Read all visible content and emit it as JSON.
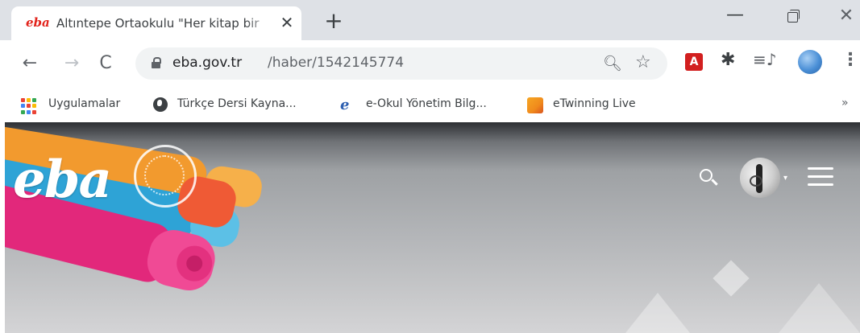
{
  "browser": {
    "tab": {
      "favicon_text": "eba",
      "title": "Altıntepe Ortaokulu \"Her kitap bir",
      "close_glyph": "✕"
    },
    "new_tab_glyph": "+",
    "window_controls": {
      "minimize_glyph": "—",
      "close_glyph": "✕"
    },
    "nav": {
      "back_glyph": "←",
      "forward_glyph": "→",
      "reload_glyph": "C"
    },
    "address": {
      "domain": "eba.gov.tr",
      "path": "/haber/1542145774"
    },
    "toolbar_icons": {
      "zoom_glyph": "🔍︎",
      "star_glyph": "☆",
      "pdf_ext_glyph": "A",
      "puzzle_glyph": "✱",
      "media_glyph": "≡♪",
      "menu_glyph": "⋮"
    },
    "bookmarks": [
      {
        "label": "Uygulamalar",
        "icon": "apps-grid-icon"
      },
      {
        "label": "Türkçe Dersi Kayna...",
        "icon": "globe-icon"
      },
      {
        "label": "e-Okul Yönetim Bilg...",
        "icon": "eokul-icon"
      },
      {
        "label": "eTwinning Live",
        "icon": "etwinning-icon"
      }
    ],
    "bookmarks_overflow": "»"
  },
  "page": {
    "logo_text": "eba",
    "user_caret": "▾"
  },
  "colors": {
    "tabstrip_bg": "#dee1e6",
    "brand_red": "#e2241c",
    "apps_dots": [
      "#ea4335",
      "#fbbc05",
      "#34a853",
      "#4285f4",
      "#ea4335",
      "#fbbc05",
      "#34a853",
      "#4285f4",
      "#ea4335"
    ]
  }
}
